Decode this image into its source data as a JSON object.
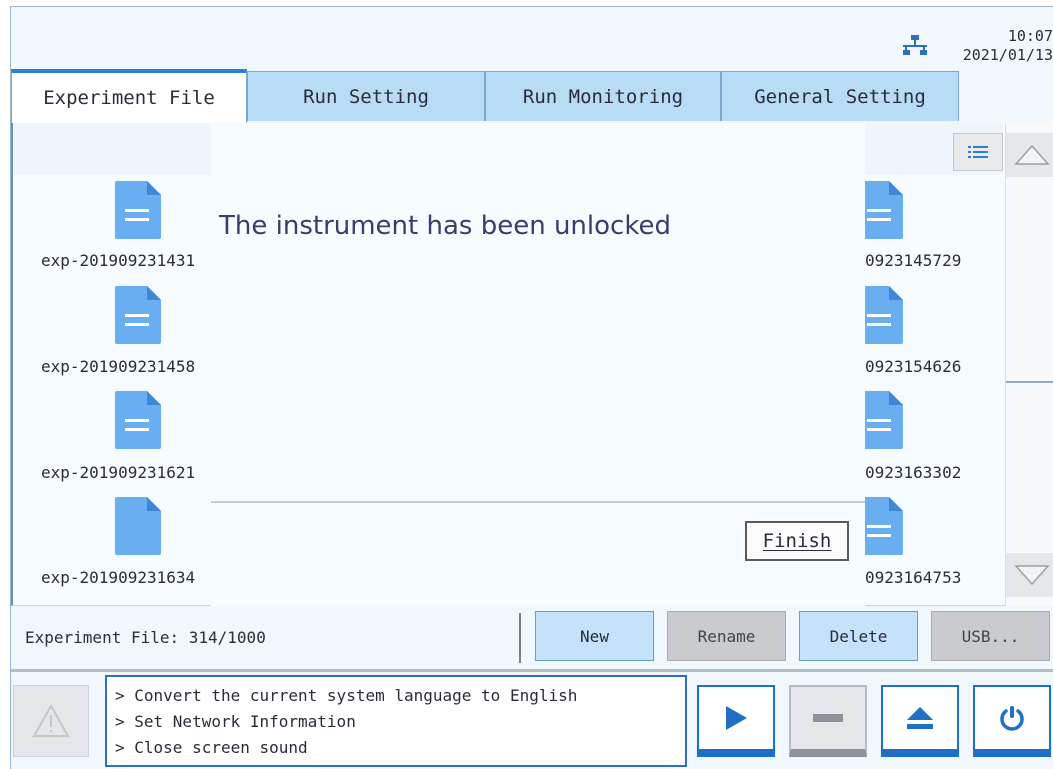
{
  "status": {
    "network_icon": "network-icon",
    "time": "10:07",
    "date": "2021/01/13"
  },
  "tabs": [
    {
      "label": "Experiment File",
      "active": true
    },
    {
      "label": "Run Setting",
      "active": false
    },
    {
      "label": "Run Monitoring",
      "active": false
    },
    {
      "label": "General Setting",
      "active": false
    }
  ],
  "files": {
    "left": [
      "exp-201909231431",
      "exp-201909231458",
      "exp-201909231621",
      "exp-201909231634"
    ],
    "right": [
      "0923145729",
      "0923154626",
      "0923163302",
      "0923164753"
    ]
  },
  "dialog": {
    "message": "The instrument has been unlocked",
    "finish_label": "Finish"
  },
  "action_bar": {
    "file_count": "Experiment File: 314/1000",
    "new_label": "New",
    "rename_label": "Rename",
    "delete_label": "Delete",
    "usb_label": "USB..."
  },
  "messages": [
    "> Convert the current system language to English",
    "> Set Network Information",
    "> Close screen sound"
  ],
  "colors": {
    "accent": "#1f6fc7",
    "tab_inactive": "#b8dcf6",
    "file_icon": "#6aaef2"
  }
}
